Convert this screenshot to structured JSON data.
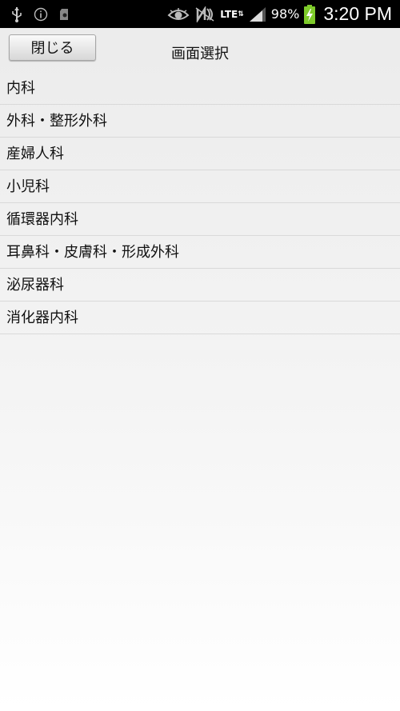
{
  "status_bar": {
    "network": "LTE",
    "battery": "98%",
    "time": "3:20 PM",
    "icons": [
      "usb-icon",
      "info-icon",
      "sd-card-icon",
      "eye-icon",
      "nfc-icon",
      "lte-icon",
      "signal-icon",
      "battery-charging-icon"
    ]
  },
  "header": {
    "close_label": "閉じる",
    "title": "画面選択"
  },
  "menu": {
    "items": [
      {
        "label": "内科"
      },
      {
        "label": "外科・整形外科"
      },
      {
        "label": "産婦人科"
      },
      {
        "label": "小児科"
      },
      {
        "label": "循環器内科"
      },
      {
        "label": "耳鼻科・皮膚科・形成外科"
      },
      {
        "label": "泌尿器科"
      },
      {
        "label": "消化器内科"
      }
    ]
  },
  "colors": {
    "status_bar_bg": "#000000",
    "battery_charge": "#7ecb2a",
    "divider": "#d9d9d9"
  }
}
